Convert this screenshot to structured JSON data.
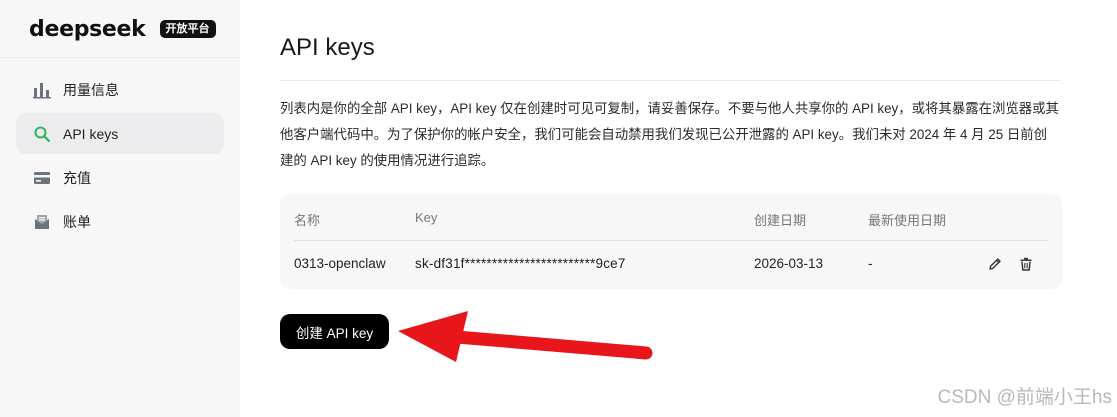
{
  "brand": {
    "name": "deepseek",
    "badge": "开放平台"
  },
  "sidebar": {
    "items": [
      {
        "label": "用量信息",
        "icon": "bar-chart-icon",
        "active": false
      },
      {
        "label": "API keys",
        "icon": "search-key-icon",
        "active": true
      },
      {
        "label": "充值",
        "icon": "credit-card-icon",
        "active": false
      },
      {
        "label": "账单",
        "icon": "bill-icon",
        "active": false
      }
    ]
  },
  "main": {
    "title": "API keys",
    "description": "列表内是你的全部 API key，API key 仅在创建时可见可复制，请妥善保存。不要与他人共享你的 API key，或将其暴露在浏览器或其他客户端代码中。为了保护你的帐户安全，我们可能会自动禁用我们发现已公开泄露的 API key。我们未对 2024 年 4 月 25 日前创建的 API key 的使用情况进行追踪。",
    "table": {
      "headers": {
        "name": "名称",
        "key": "Key",
        "created": "创建日期",
        "last_used": "最新使用日期"
      },
      "rows": [
        {
          "name": "0313-openclaw",
          "key": "sk-df31f************************9ce7",
          "created": "2026-03-13",
          "last_used": "-"
        }
      ]
    },
    "create_button": "创建 API key"
  },
  "annotation": {
    "arrow_color": "#e8161b"
  },
  "watermark": "CSDN @前端小王hs",
  "colors": {
    "accent_green": "#2db55d",
    "button_bg": "#000000",
    "sidebar_bg": "#f7f7f8"
  }
}
